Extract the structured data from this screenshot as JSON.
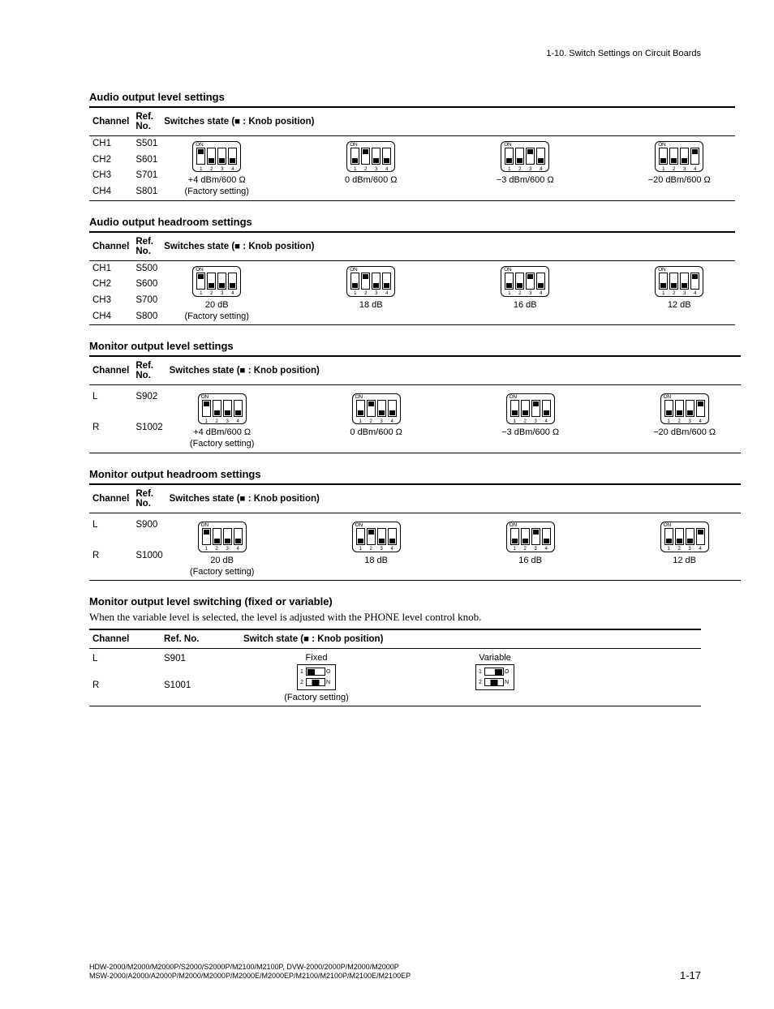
{
  "header": {
    "section_ref": "1-10. Switch Settings on Circuit Boards"
  },
  "common": {
    "th_channel": "Channel",
    "th_refno": "Ref. No.",
    "th_switches": "Switches state (■ : Knob position)",
    "th_switch": "Switch state (■ : Knob position)",
    "factory": "(Factory setting)",
    "nums": [
      "1",
      "2",
      "3",
      "4"
    ],
    "on": "ON"
  },
  "sections": {
    "audio_output_level": {
      "title": "Audio output level settings",
      "rows": [
        {
          "channel": "CH1",
          "ref": "S501"
        },
        {
          "channel": "CH2",
          "ref": "S601"
        },
        {
          "channel": "CH3",
          "ref": "S701"
        },
        {
          "channel": "CH4",
          "ref": "S801"
        }
      ],
      "options": [
        {
          "label": "+4 dBm/600 Ω",
          "factory": true
        },
        {
          "label": "0 dBm/600 Ω"
        },
        {
          "label": "−3 dBm/600 Ω"
        },
        {
          "label": "−20 dBm/600 Ω"
        }
      ]
    },
    "audio_output_headroom": {
      "title": "Audio output headroom settings",
      "rows": [
        {
          "channel": "CH1",
          "ref": "S500"
        },
        {
          "channel": "CH2",
          "ref": "S600"
        },
        {
          "channel": "CH3",
          "ref": "S700"
        },
        {
          "channel": "CH4",
          "ref": "S800"
        }
      ],
      "options": [
        {
          "label": "20 dB",
          "factory": true
        },
        {
          "label": "18 dB"
        },
        {
          "label": "16 dB"
        },
        {
          "label": "12 dB"
        }
      ]
    },
    "monitor_output_level": {
      "title": "Monitor output level settings",
      "rows": [
        {
          "channel": "L",
          "ref": "S902"
        },
        {
          "channel": "R",
          "ref": "S1002"
        }
      ],
      "options": [
        {
          "label": "+4 dBm/600 Ω",
          "factory": true
        },
        {
          "label": "0 dBm/600 Ω"
        },
        {
          "label": "−3 dBm/600 Ω"
        },
        {
          "label": "−20 dBm/600 Ω"
        }
      ]
    },
    "monitor_output_headroom": {
      "title": "Monitor output headroom settings",
      "rows": [
        {
          "channel": "L",
          "ref": "S900"
        },
        {
          "channel": "R",
          "ref": "S1000"
        }
      ],
      "options": [
        {
          "label": "20 dB",
          "factory": true
        },
        {
          "label": "18 dB"
        },
        {
          "label": "16 dB"
        },
        {
          "label": "12 dB"
        }
      ]
    },
    "monitor_output_switching": {
      "title": "Monitor output level switching (fixed or variable)",
      "note": "When the variable level is selected, the level is adjusted with the PHONE level control knob.",
      "rows": [
        {
          "channel": "L",
          "ref": "S901"
        },
        {
          "channel": "R",
          "ref": "S1001"
        }
      ],
      "options": [
        {
          "label": "Fixed",
          "factory": true
        },
        {
          "label": "Variable"
        }
      ],
      "sw2_labels": {
        "o": "O",
        "n": "N",
        "r1": "1",
        "r2": "2"
      }
    }
  },
  "footer": {
    "models_line1": "HDW-2000/M2000/M2000P/S2000/S2000P/M2100/M2100P, DVW-2000/2000P/M2000/M2000P",
    "models_line2": "MSW-2000/A2000/A2000P/M2000/M2000P/M2000E/M2000EP/M2100/M2100P/M2100E/M2100EP",
    "page": "1-17"
  },
  "dip_patterns": {
    "aol": [
      [
        "top",
        "bot",
        "bot",
        "bot"
      ],
      [
        "bot",
        "top",
        "bot",
        "bot"
      ],
      [
        "bot",
        "bot",
        "top",
        "bot"
      ],
      [
        "bot",
        "bot",
        "bot",
        "top"
      ]
    ],
    "aoh": [
      [
        "top",
        "bot",
        "bot",
        "bot"
      ],
      [
        "bot",
        "top",
        "bot",
        "bot"
      ],
      [
        "bot",
        "bot",
        "top",
        "bot"
      ],
      [
        "bot",
        "bot",
        "bot",
        "top"
      ]
    ],
    "mol": [
      [
        "top",
        "bot",
        "bot",
        "bot"
      ],
      [
        "bot",
        "top",
        "bot",
        "bot"
      ],
      [
        "bot",
        "bot",
        "top",
        "bot"
      ],
      [
        "bot",
        "bot",
        "bot",
        "top"
      ]
    ],
    "moh": [
      [
        "top",
        "bot",
        "bot",
        "bot"
      ],
      [
        "bot",
        "top",
        "bot",
        "bot"
      ],
      [
        "bot",
        "bot",
        "top",
        "bot"
      ],
      [
        "bot",
        "bot",
        "bot",
        "top"
      ]
    ]
  },
  "sw2_patterns": {
    "fixed": {
      "r1": "left",
      "r2": "mid"
    },
    "variable": {
      "r1": "right",
      "r2": "mid"
    }
  }
}
